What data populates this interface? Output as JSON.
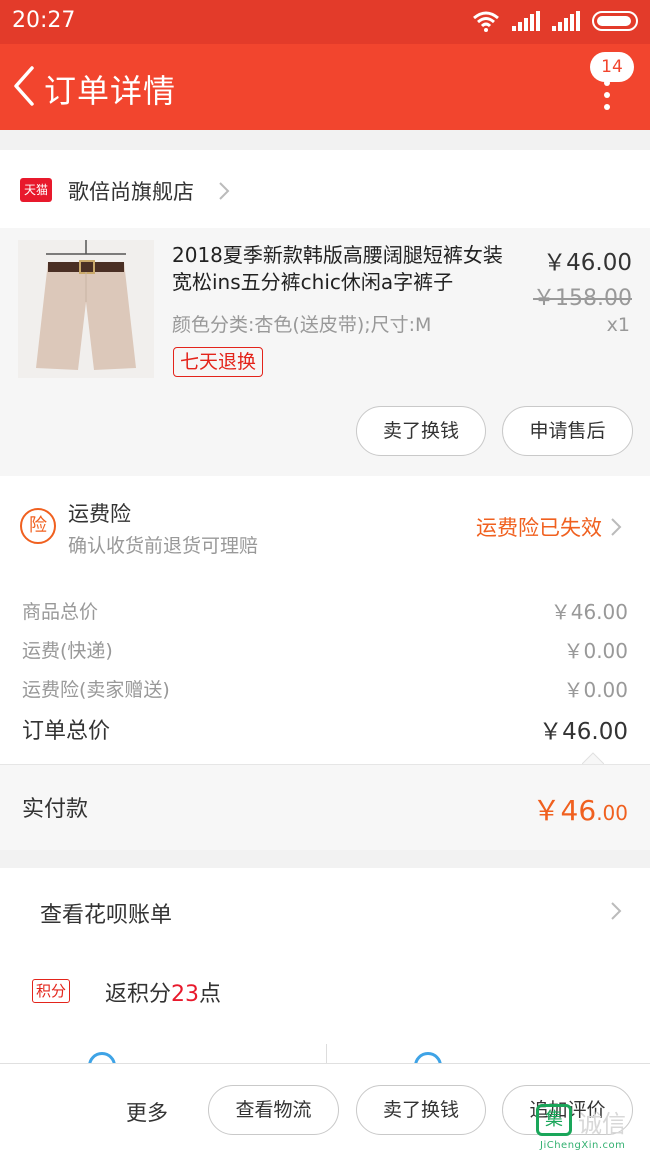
{
  "status_bar": {
    "time": "20:27"
  },
  "header": {
    "title": "订单详情",
    "badge": "14"
  },
  "shop": {
    "logo_text": "天猫",
    "name": "歌倍尚旗舰店"
  },
  "product": {
    "title": "2018夏季新款韩版高腰阔腿短裤女装宽松ins五分裤chic休闲a字裤子",
    "sku": "颜色分类:杏色(送皮带);尺寸:M",
    "return_tag": "七天退换",
    "price": "￥46.00",
    "original_price": "￥158.00",
    "quantity": "x1",
    "actions": {
      "sell": "卖了换钱",
      "after_sale": "申请售后"
    }
  },
  "insurance": {
    "icon_text": "险",
    "title": "运费险",
    "desc": "确认收货前退货可理赔",
    "status": "运费险已失效"
  },
  "summary": {
    "rows": [
      {
        "label": "商品总价",
        "value": "￥46.00"
      },
      {
        "label": "运费(快递)",
        "value": "￥0.00"
      },
      {
        "label": "运费险(卖家赠送)",
        "value": "￥0.00"
      }
    ],
    "total": {
      "label": "订单总价",
      "value": "￥46.00"
    }
  },
  "paid": {
    "label": "实付款",
    "value_main": "￥46",
    "value_decimal": ".00"
  },
  "extras": {
    "bill_label": "查看花呗账单",
    "points_tag": "积分",
    "points_prefix": "返积分",
    "points_value": "23",
    "points_suffix": "点"
  },
  "bottom_bar": {
    "more": "更多",
    "logistics": "查看物流",
    "sell": "卖了换钱",
    "review": "追加评价"
  },
  "watermark": {
    "logo": "集",
    "text": "诚信",
    "domain": "JiChengXin.com"
  },
  "colors": {
    "header": "#f2452e",
    "accent_orange": "#f0601f",
    "tag_red": "#e3241b"
  }
}
